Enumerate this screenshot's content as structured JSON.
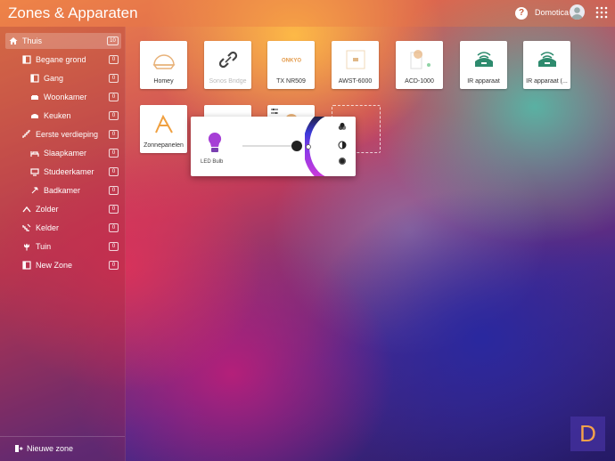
{
  "header": {
    "title": "Zones & Apparaten",
    "help_label": "?",
    "user_name": "Domotica"
  },
  "sidebar": {
    "items": [
      {
        "label": "Thuis",
        "count": "10",
        "icon": "home-icon"
      },
      {
        "label": "Begane grond",
        "count": "0",
        "icon": "floor-icon"
      },
      {
        "label": "Gang",
        "count": "0",
        "icon": "door-icon"
      },
      {
        "label": "Woonkamer",
        "count": "0",
        "icon": "sofa-icon"
      },
      {
        "label": "Keuken",
        "count": "0",
        "icon": "kitchen-icon"
      },
      {
        "label": "Eerste verdieping",
        "count": "0",
        "icon": "stairs-icon"
      },
      {
        "label": "Slaapkamer",
        "count": "0",
        "icon": "bed-icon"
      },
      {
        "label": "Studeerkamer",
        "count": "0",
        "icon": "desk-icon"
      },
      {
        "label": "Badkamer",
        "count": "0",
        "icon": "shower-icon"
      },
      {
        "label": "Zolder",
        "count": "0",
        "icon": "attic-icon"
      },
      {
        "label": "Kelder",
        "count": "0",
        "icon": "cellar-icon"
      },
      {
        "label": "Tuin",
        "count": "0",
        "icon": "tulip-icon"
      },
      {
        "label": "New Zone",
        "count": "0",
        "icon": "floor-icon"
      }
    ],
    "new_zone_label": "Nieuwe zone"
  },
  "devices": [
    {
      "name": "Homey",
      "icon": "homey-icon"
    },
    {
      "name": "Sonos Bridge",
      "icon": "link-icon"
    },
    {
      "name": "TX NR509",
      "icon": "onkyo-logo-icon"
    },
    {
      "name": "AWST-6000",
      "icon": "wall-switch-icon"
    },
    {
      "name": "ACD-1000",
      "icon": "dimmer-icon"
    },
    {
      "name": "IR apparaat",
      "icon": "ir-blaster-icon"
    },
    {
      "name": "IR apparaat (...",
      "icon": "ir-blaster-icon"
    },
    {
      "name": "Zonnepanelen",
      "icon": "solar-icon"
    }
  ],
  "brand_logo_text": "ONKYO",
  "popup": {
    "device_name": "LED Bulb",
    "dim_level_percent": 95,
    "modes": [
      "color-mode-icon",
      "temperature-mode-icon",
      "brightness-mode-icon"
    ]
  },
  "corner_logo": "D",
  "colors": {
    "accent": "#f5a24a",
    "ir_green": "#2e8b6e",
    "bulb_purple": "#a63fd6"
  }
}
